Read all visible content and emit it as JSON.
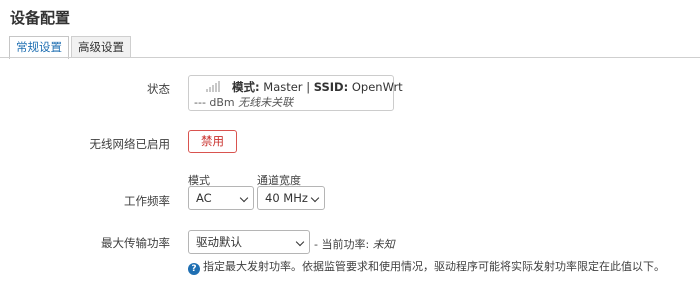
{
  "page": {
    "title": "设备配置"
  },
  "tabs": [
    {
      "label": "常规设置",
      "active": true
    },
    {
      "label": "高级设置",
      "active": false
    }
  ],
  "status": {
    "label": "状态",
    "mode_label": "模式:",
    "mode_value": "Master",
    "separator": "|",
    "ssid_label": "SSID:",
    "ssid_value": "OpenWrt",
    "signal_text": "--- dBm",
    "association": "无线未关联",
    "icon": "signal-strength-icon"
  },
  "wireless_enabled": {
    "label": "无线网络已启用",
    "button": "禁用"
  },
  "frequency": {
    "label": "工作频率",
    "mode_label": "模式",
    "mode_value": "AC",
    "width_label": "通道宽度",
    "width_value": "40 MHz"
  },
  "tx_power": {
    "label": "最大传输功率",
    "value": "驱动默认",
    "current_prefix": "- 当前功率:",
    "current_value": "未知",
    "help": "指定最大发射功率。依据监管要求和使用情况，驱动程序可能将实际发射功率限定在此值以下。",
    "help_icon": "question-icon"
  },
  "colors": {
    "accent": "#1f6fb2",
    "danger": "#d9534f"
  }
}
